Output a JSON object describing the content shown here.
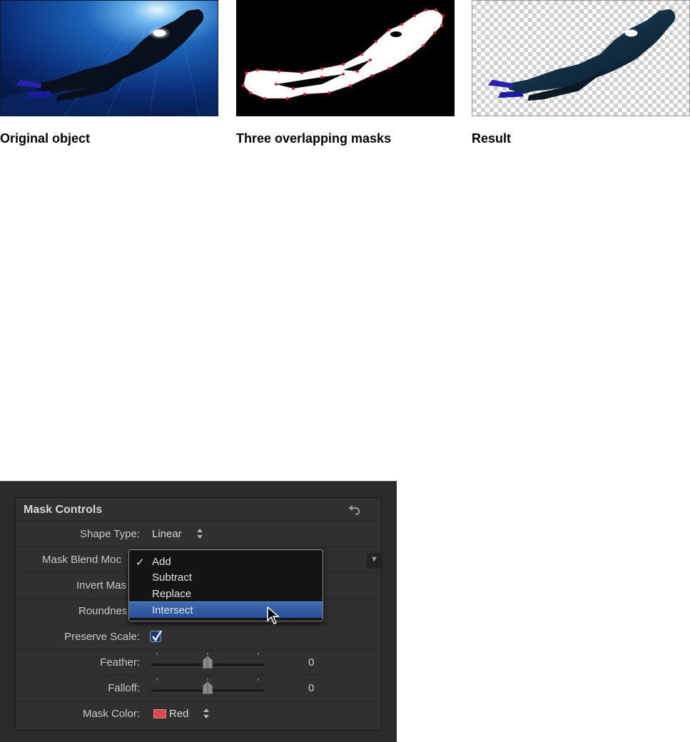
{
  "figures": {
    "captions": [
      "Original object",
      "Three overlapping masks",
      "Result"
    ]
  },
  "inspector": {
    "panel_title": "Mask Controls",
    "rows": {
      "shape_type": {
        "label": "Shape Type:",
        "value": "Linear"
      },
      "mask_blend_mode": {
        "label": "Mask Blend Mode:",
        "visible_label": "Mask Blend Moc"
      },
      "invert_mask": {
        "label": "Invert Mas"
      },
      "roundness": {
        "label": "Roundnes"
      },
      "preserve_scale": {
        "label": "Preserve Scale:",
        "checked": true
      },
      "feather": {
        "label": "Feather:",
        "value": "0"
      },
      "falloff": {
        "label": "Falloff:",
        "value": "0"
      },
      "mask_color": {
        "label": "Mask Color:",
        "value": "Red",
        "swatch": "#d94c4c"
      }
    },
    "blend_dropdown": {
      "check_glyph": "✓",
      "options": [
        "Add",
        "Subtract",
        "Replace",
        "Intersect"
      ],
      "checked_option": "Add",
      "highlighted_option": "Intersect"
    }
  },
  "colors": {
    "panel_bg": "#303030",
    "highlight": "#3a64ad",
    "mask_points": "#d6242a"
  },
  "icons": [
    "reset-icon",
    "updown-arrows-icon",
    "checkmark-icon",
    "slider-knob-icon",
    "popup-arrow-icon",
    "mouse-cursor-icon"
  ]
}
